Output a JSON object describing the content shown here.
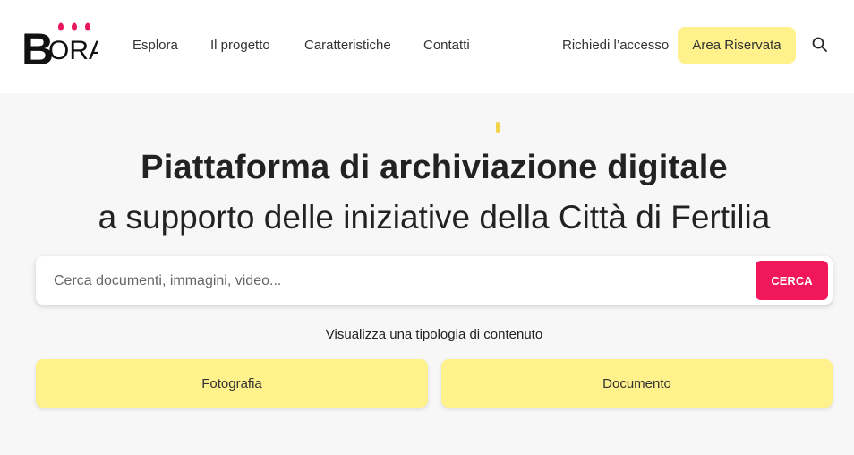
{
  "header": {
    "logo_text": "BORA",
    "nav": [
      "Esplora",
      "Il progetto",
      "Caratteristiche",
      "Contatti"
    ],
    "access_link": "Richiedi l’accesso",
    "area_button": "Area Riservata"
  },
  "hero": {
    "title_strong": "Piattaforma di archiviazione digitale",
    "title_light": "a supporto delle iniziative della Città di Fertilia"
  },
  "search": {
    "placeholder": "Cerca documenti, immagini, video...",
    "value": "",
    "button_label": "CERCA"
  },
  "content_types": {
    "label": "Visualizza una tipologia di contenuto",
    "items": [
      "Fotografia",
      "Documento"
    ]
  },
  "colors": {
    "accent_yellow": "#fff18c",
    "cta_pink": "#f0185a",
    "logo_pink": "#e8175d"
  }
}
